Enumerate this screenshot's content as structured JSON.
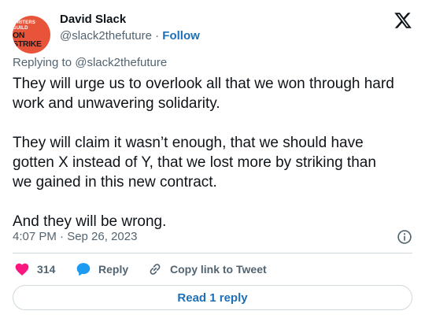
{
  "author": {
    "name": "David Slack",
    "handle": "@slack2thefuture",
    "separator": "·",
    "follow_label": "Follow",
    "avatar_top_text": "WRITERS GUILD",
    "avatar_main_text": "ON STRIKE"
  },
  "replying": {
    "prefix": "Replying to ",
    "mention": "@slack2thefuture"
  },
  "tweet": {
    "text": "They will urge us to overlook all that we won through hard\nwork and unwavering solidarity.\n\nThey will claim it wasn’t enough, that we should have\ngotten X instead of Y, that we lost more by striking than\nwe gained in this new contract.\n\nAnd they will be wrong.",
    "timestamp": "4:07 PM · Sep 26, 2023"
  },
  "actions": {
    "like_count": "314",
    "reply_label": "Reply",
    "copy_label": "Copy link to Tweet"
  },
  "footer": {
    "read_replies_label": "Read 1 reply"
  },
  "colors": {
    "link_blue": "#1d6fb8",
    "heart_red": "#f91880",
    "reply_blue": "#1d9bf0",
    "avatar_bg": "#e8543a"
  },
  "icons": {
    "logo": "x-logo-icon",
    "info": "info-icon",
    "like": "heart-icon",
    "reply": "speech-bubble-icon",
    "copy": "link-icon"
  }
}
